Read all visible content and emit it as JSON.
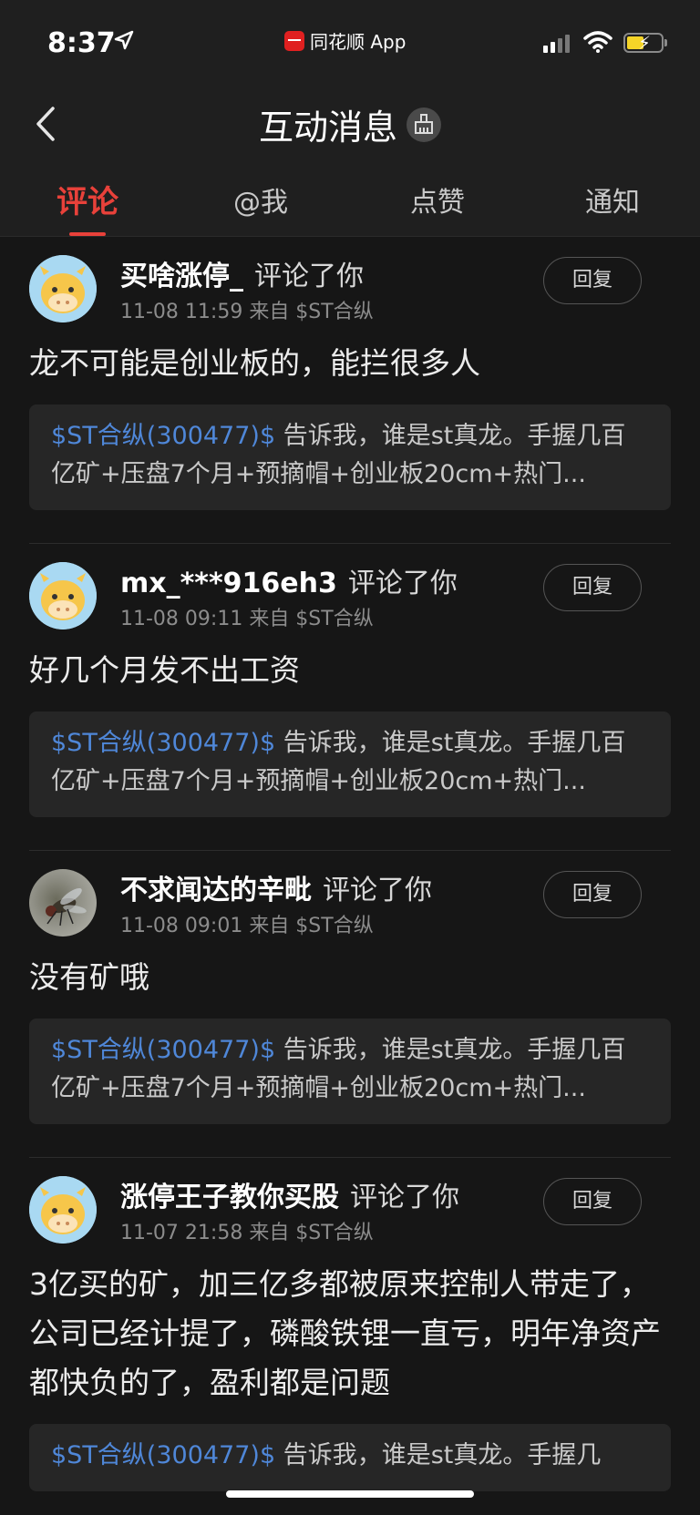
{
  "status_bar": {
    "time": "8:37",
    "back_app_label": "同花顺 App"
  },
  "nav": {
    "title": "互动消息"
  },
  "tabs": [
    {
      "label": "评论",
      "active": true
    },
    {
      "label": "@我",
      "active": false
    },
    {
      "label": "点赞",
      "active": false
    },
    {
      "label": "通知",
      "active": false
    }
  ],
  "items": [
    {
      "avatar": "cow-avatar",
      "username": "买啥涨停_",
      "action": "评论了你",
      "meta": "11-08 11:59 来自 $ST合纵",
      "reply_label": "回复",
      "content": "龙不可能是创业板的，能拦很多人",
      "quote_stock": "$ST合纵(300477)$",
      "quote_text": " 告诉我，谁是st真龙。手握几百亿矿+压盘7个月+预摘帽+创业板20cm+热门..."
    },
    {
      "avatar": "cow-avatar",
      "username": "mx_***916eh3",
      "action": "评论了你",
      "meta": "11-08 09:11 来自 $ST合纵",
      "reply_label": "回复",
      "content": "好几个月发不出工资",
      "quote_stock": "$ST合纵(300477)$",
      "quote_text": " 告诉我，谁是st真龙。手握几百亿矿+压盘7个月+预摘帽+创业板20cm+热门..."
    },
    {
      "avatar": "fly-photo-avatar",
      "username": "不求闻达的辛毗",
      "action": "评论了你",
      "meta": "11-08 09:01 来自 $ST合纵",
      "reply_label": "回复",
      "content": "没有矿哦",
      "quote_stock": "$ST合纵(300477)$",
      "quote_text": " 告诉我，谁是st真龙。手握几百亿矿+压盘7个月+预摘帽+创业板20cm+热门..."
    },
    {
      "avatar": "cow-avatar",
      "username": "涨停王子教你买股",
      "action": "评论了你",
      "meta": "11-07 21:58 来自 $ST合纵",
      "reply_label": "回复",
      "content": "3亿买的矿，加三亿多都被原来控制人带走了，公司已经计提了，磷酸铁锂一直亏，明年净资产都快负的了，盈利都是问题",
      "quote_stock": "$ST合纵(300477)$",
      "quote_text": " 告诉我，谁是st真龙。手握几"
    }
  ],
  "colors": {
    "accent": "#e8413a",
    "stock_link": "#4f87d8",
    "background": "#161616"
  }
}
